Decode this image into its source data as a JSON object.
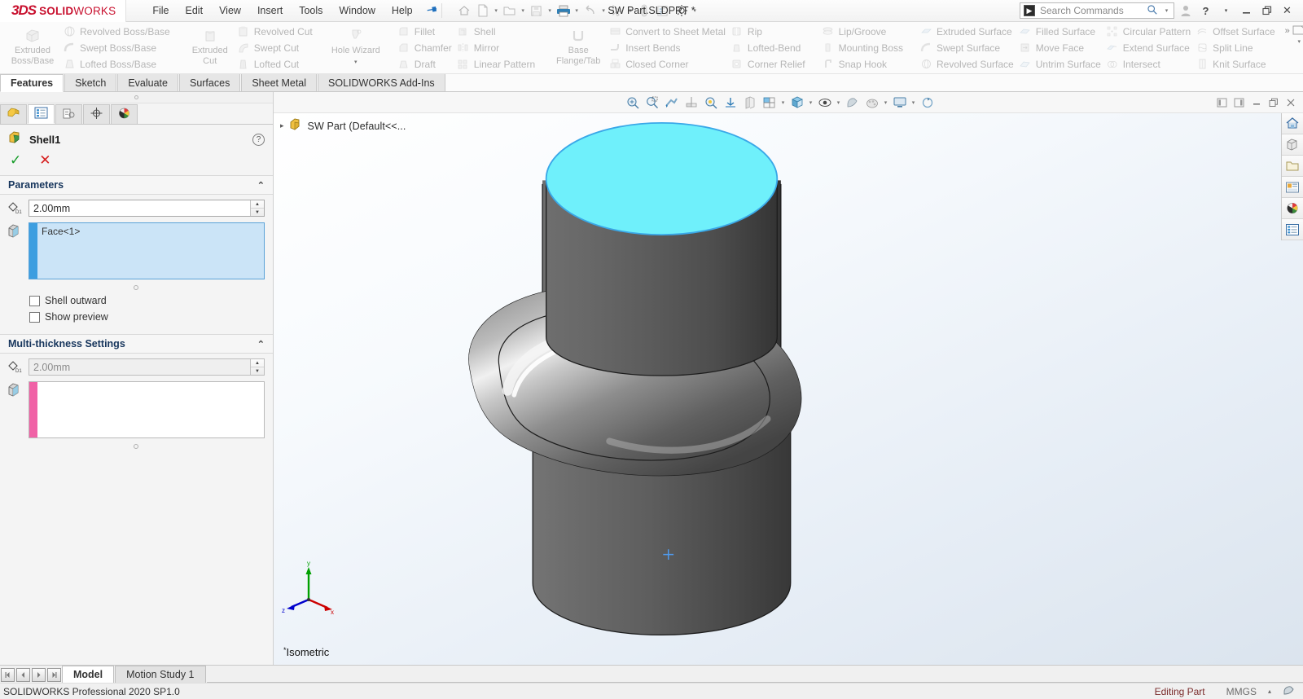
{
  "window": {
    "brand_ds": "3DS",
    "brand_solid": "SOLID",
    "brand_works": "WORKS",
    "document_title": "SW Part.SLDPRT *",
    "minimize": "–",
    "restore": "❐",
    "close": "✕",
    "help": "?",
    "help_arrow": "▾",
    "user_icon": "user-icon"
  },
  "menu": {
    "items": [
      "File",
      "Edit",
      "View",
      "Insert",
      "Tools",
      "Window",
      "Help"
    ],
    "pin": "✒"
  },
  "quick_access": {
    "items": [
      "home-icon",
      "new-doc-icon",
      "open-folder-icon",
      "save-icon",
      "print-icon",
      "undo-icon",
      "select-arrow-icon",
      "rebuild-icon",
      "options-list-icon",
      "settings-gear-icon"
    ]
  },
  "search": {
    "placeholder": "Search Commands",
    "value": "",
    "icon": "search-magnifier-icon",
    "dropdown": "▾"
  },
  "ribbon": {
    "groups": [
      {
        "big": [
          {
            "label": "Extruded\nBoss/Base",
            "icon": "extruded-boss-icon"
          }
        ],
        "small": [
          {
            "label": "Revolved Boss/Base",
            "icon": "revolved-boss-icon"
          },
          {
            "label": "Swept Boss/Base",
            "icon": "swept-boss-icon"
          },
          {
            "label": "Lofted Boss/Base",
            "icon": "lofted-boss-icon"
          }
        ]
      },
      {
        "big": [
          {
            "label": "Extruded\nCut",
            "icon": "extruded-cut-icon"
          }
        ],
        "small": [
          {
            "label": "Revolved Cut",
            "icon": "revolved-cut-icon"
          },
          {
            "label": "Swept Cut",
            "icon": "swept-cut-icon"
          },
          {
            "label": "Lofted Cut",
            "icon": "lofted-cut-icon"
          }
        ]
      },
      {
        "big": [
          {
            "label": "Hole Wizard",
            "icon": "hole-wizard-icon"
          }
        ],
        "small": []
      },
      {
        "big": [],
        "small": [
          {
            "label": "Fillet",
            "icon": "fillet-icon"
          },
          {
            "label": "Chamfer",
            "icon": "chamfer-icon"
          },
          {
            "label": "Draft",
            "icon": "draft-icon"
          }
        ]
      },
      {
        "big": [],
        "small": [
          {
            "label": "Shell",
            "icon": "shell-icon"
          },
          {
            "label": "Mirror",
            "icon": "mirror-icon"
          },
          {
            "label": "Linear Pattern",
            "icon": "linear-pattern-icon"
          }
        ]
      },
      {
        "big": [
          {
            "label": "Base\nFlange/Tab",
            "icon": "base-flange-icon"
          }
        ],
        "small": [
          {
            "label": "Convert to Sheet Metal",
            "icon": "convert-sheet-metal-icon"
          },
          {
            "label": "Insert Bends",
            "icon": "insert-bends-icon"
          },
          {
            "label": "Closed Corner",
            "icon": "closed-corner-icon"
          }
        ]
      },
      {
        "big": [],
        "small": [
          {
            "label": "Rip",
            "icon": "rip-icon"
          },
          {
            "label": "Lofted-Bend",
            "icon": "lofted-bend-icon"
          },
          {
            "label": "Corner Relief",
            "icon": "corner-relief-icon"
          }
        ]
      },
      {
        "big": [],
        "small": [
          {
            "label": "Lip/Groove",
            "icon": "lip-groove-icon"
          },
          {
            "label": "Mounting Boss",
            "icon": "mounting-boss-icon"
          },
          {
            "label": "Snap Hook",
            "icon": "snap-hook-icon"
          }
        ]
      },
      {
        "big": [],
        "small": [
          {
            "label": "Extruded Surface",
            "icon": "extruded-surface-icon"
          },
          {
            "label": "Swept Surface",
            "icon": "swept-surface-icon"
          },
          {
            "label": "Revolved Surface",
            "icon": "revolved-surface-icon"
          }
        ]
      },
      {
        "big": [],
        "small": [
          {
            "label": "Filled Surface",
            "icon": "filled-surface-icon"
          },
          {
            "label": "Move Face",
            "icon": "move-face-icon"
          },
          {
            "label": "Untrim Surface",
            "icon": "untrim-surface-icon"
          }
        ]
      },
      {
        "big": [],
        "small": [
          {
            "label": "Circular Pattern",
            "icon": "circular-pattern-icon"
          },
          {
            "label": "Extend Surface",
            "icon": "extend-surface-icon"
          },
          {
            "label": "Intersect",
            "icon": "intersect-icon"
          }
        ]
      },
      {
        "big": [],
        "small": [
          {
            "label": "Offset Surface",
            "icon": "offset-surface-icon"
          },
          {
            "label": "Split Line",
            "icon": "split-line-icon"
          },
          {
            "label": "Knit Surface",
            "icon": "knit-surface-icon"
          }
        ]
      }
    ],
    "overflow": "»"
  },
  "command_tabs": {
    "items": [
      "Features",
      "Sketch",
      "Evaluate",
      "Surfaces",
      "Sheet Metal",
      "SOLIDWORKS Add-Ins"
    ],
    "selected": "Features"
  },
  "property_manager": {
    "tabs": [
      "feature-tree-icon",
      "property-manager-icon",
      "configuration-manager-icon",
      "dimxpert-icon",
      "appearances-icon"
    ],
    "selected_tab_index": 1,
    "title": "Shell1",
    "title_icon": "shell-feature-icon",
    "help_icon": "?",
    "accept_icon": "✓",
    "cancel_icon": "✕",
    "sections": [
      {
        "name": "Parameters",
        "collapse_icon": "⌃",
        "thickness": {
          "icon": "thickness-d1-icon",
          "value": "2.00mm",
          "disabled": false
        },
        "faces": {
          "icon": "face-select-icon",
          "items": [
            "Face<1>"
          ],
          "selected": true
        },
        "checkboxes": [
          {
            "label": "Shell outward",
            "checked": false
          },
          {
            "label": "Show preview",
            "checked": false
          }
        ]
      },
      {
        "name": "Multi-thickness Settings",
        "collapse_icon": "⌃",
        "thickness": {
          "icon": "thickness-d1-icon",
          "value": "2.00mm",
          "disabled": true
        },
        "faces": {
          "icon": "face-select-icon",
          "items": [],
          "selected": false
        }
      }
    ]
  },
  "view_toolbar": {
    "icons": [
      "zoom-to-fit-icon",
      "zoom-to-area-icon",
      "previous-view-icon",
      "section-view-icon",
      "measure-icon",
      "view-orientation-icon",
      "display-style-icon",
      "hide-show-icon",
      "edit-appearance-icon",
      "apply-scene-icon",
      "view-settings-icon",
      "rotate-icon"
    ],
    "window_buttons": [
      "restore-down-left",
      "restore-down-right",
      "minimize",
      "restore",
      "close"
    ]
  },
  "feature_tree": {
    "arrow": "▸",
    "icon": "part-icon",
    "label": "SW Part  (Default<<..."
  },
  "graphics": {
    "view_name": "Isometric",
    "view_prefix": "*",
    "confirm_icon": "✓",
    "cancel_icon": "✕",
    "selected_face_color": "#6ff0fb",
    "body_color": "#5a5a5a",
    "background_top": "#ffffff",
    "background_bottom": "#dbe4ee",
    "triad": {
      "x": "x",
      "y": "y",
      "z": "z",
      "x_color": "#cc0000",
      "y_color": "#00a000",
      "z_color": "#0000cc"
    },
    "origin_marker": "+"
  },
  "task_rail": {
    "items": [
      "solidworks-resources-home-icon",
      "design-library-icon",
      "file-explorer-icon",
      "view-palette-icon",
      "appearances-scenes-icon",
      "custom-properties-icon"
    ]
  },
  "bottom": {
    "nav_buttons": [
      "⏮",
      "◀",
      "▶",
      "⏭"
    ],
    "tabs": [
      "Model",
      "Motion Study 1"
    ],
    "selected_tab": "Model"
  },
  "status_bar": {
    "version": "SOLIDWORKS Professional 2020 SP1.0",
    "editing": "Editing Part",
    "units": "MMGS",
    "units_arrow": "▴",
    "overlay_icon": "select-overlay-icon"
  }
}
